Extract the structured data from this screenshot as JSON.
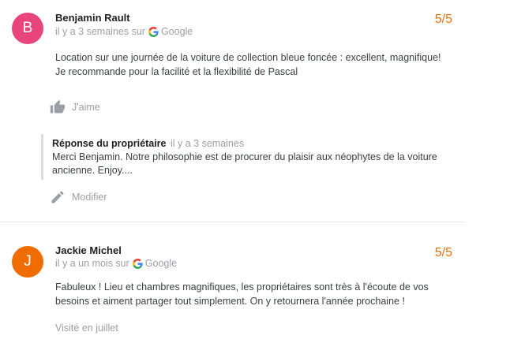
{
  "reviews": [
    {
      "avatar_letter": "B",
      "avatar_color": "#e8457c",
      "author": "Benjamin Rault",
      "time": "il y a 3 semaines sur",
      "source": "Google",
      "rating": "5/5",
      "text": "Location sur une journée de la voiture de collection bleue foncée : excellent, magnifique! Je recommande pour la facilité et la flexibilité de Pascal",
      "like_label": "J'aime",
      "owner_reply": {
        "title": "Réponse du propriétaire",
        "time": "il y a 3 semaines",
        "text": "Merci Benjamin. Notre philosophie est de procurer du plaisir aux néophytes de la voiture ancienne. Enjoy...."
      },
      "edit_label": "Modifier"
    },
    {
      "avatar_letter": "J",
      "avatar_color": "#ef6c00",
      "author": "Jackie Michel",
      "time": "il y a un mois sur",
      "source": "Google",
      "rating": "5/5",
      "text": "Fabuleux ! Lieu et chambres magnifiques, les propriétaires sont très à l'écoute de vos besoins et aiment partager tout simplement. On y retournera l'année prochaine !",
      "visited": "Visité en juillet"
    }
  ],
  "colors": {
    "rating": "#e8710a",
    "muted_text": "#9aa0a6"
  },
  "icons": {
    "source": "google-g-icon",
    "like": "thumb-up-icon",
    "edit": "pencil-icon"
  }
}
